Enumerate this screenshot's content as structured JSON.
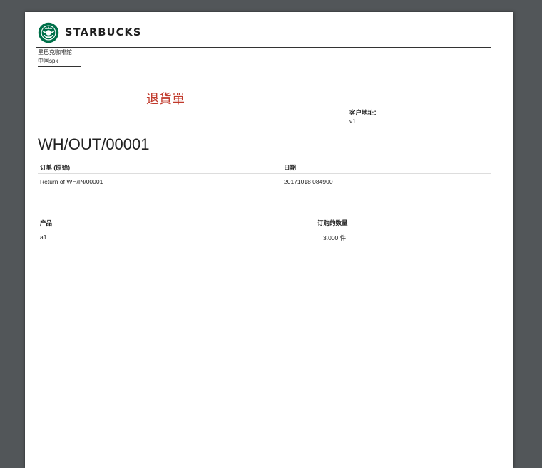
{
  "brand": {
    "name": "STARBUCKS",
    "logo_icon": "starbucks-siren-icon",
    "logo_color": "#00704A"
  },
  "company": {
    "line1": "星巴克咖啡館",
    "line2": "中国spk"
  },
  "document": {
    "title": "退貨單",
    "title_color": "#c0392b",
    "reference": "WH/OUT/00001"
  },
  "address": {
    "label": "客户地址：",
    "value": "v1"
  },
  "info_table": {
    "headers": [
      "订单 (原始)",
      "日期"
    ],
    "row": [
      "Return of WH/IN/00001",
      "20171018 084900"
    ]
  },
  "lines_table": {
    "headers": [
      "产品",
      "订购的数量"
    ],
    "rows": [
      {
        "product": "a1",
        "quantity": "3.000 件"
      }
    ]
  }
}
